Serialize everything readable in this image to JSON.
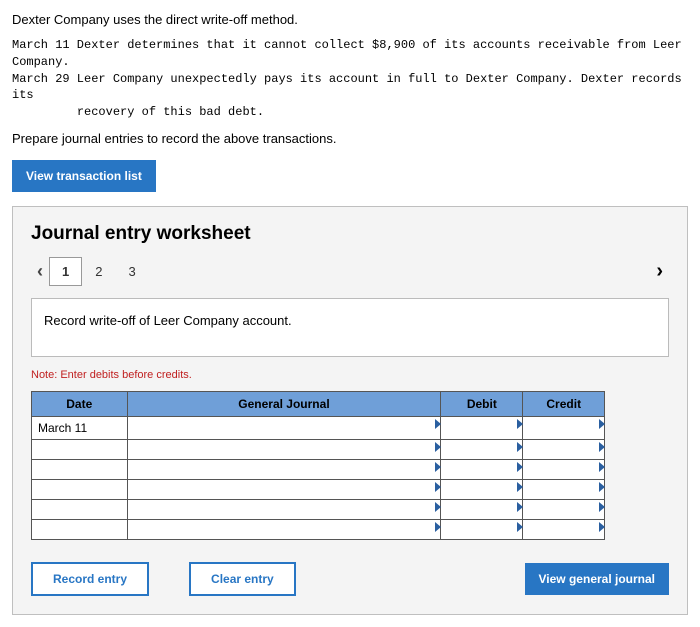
{
  "intro": "Dexter Company uses the direct write-off method.",
  "events": "March 11 Dexter determines that it cannot collect $8,900 of its accounts receivable from Leer Company.\nMarch 29 Leer Company unexpectedly pays its account in full to Dexter Company. Dexter records its\n         recovery of this bad debt.",
  "instruction": "Prepare journal entries to record the above transactions.",
  "buttons": {
    "view_list": "View transaction list",
    "record": "Record entry",
    "clear": "Clear entry",
    "view_journal": "View general journal"
  },
  "worksheet": {
    "title": "Journal entry worksheet",
    "tabs": [
      "1",
      "2",
      "3"
    ],
    "active_tab": 0,
    "prompt": "Record write-off of Leer Company account.",
    "note": "Note: Enter debits before credits.",
    "headers": {
      "date": "Date",
      "gj": "General Journal",
      "debit": "Debit",
      "credit": "Credit"
    },
    "rows": [
      {
        "date": "March 11",
        "gj": "",
        "debit": "",
        "credit": ""
      },
      {
        "date": "",
        "gj": "",
        "debit": "",
        "credit": ""
      },
      {
        "date": "",
        "gj": "",
        "debit": "",
        "credit": ""
      },
      {
        "date": "",
        "gj": "",
        "debit": "",
        "credit": ""
      },
      {
        "date": "",
        "gj": "",
        "debit": "",
        "credit": ""
      },
      {
        "date": "",
        "gj": "",
        "debit": "",
        "credit": ""
      }
    ]
  }
}
